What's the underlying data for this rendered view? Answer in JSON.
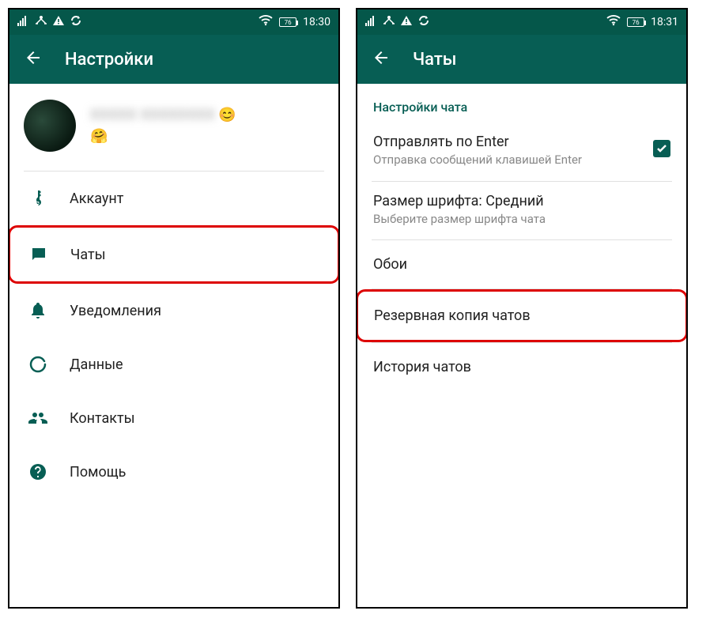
{
  "left": {
    "status": {
      "battery": "76",
      "time": "18:30"
    },
    "title": "Настройки",
    "profile": {
      "name": "XXXXX XXXXXXXX",
      "emoji1": "😊",
      "emoji2": "🤗"
    },
    "menu": {
      "account": "Аккаунт",
      "chats": "Чаты",
      "notifications": "Уведомления",
      "data": "Данные",
      "contacts": "Контакты",
      "help": "Помощь"
    }
  },
  "right": {
    "status": {
      "battery": "76",
      "time": "18:31"
    },
    "title": "Чаты",
    "section": "Настройки чата",
    "enter": {
      "title": "Отправлять по Enter",
      "sub": "Отправка сообщений клавишей Enter"
    },
    "font": {
      "title": "Размер шрифта: Средний",
      "sub": "Выберите размер шрифта чата"
    },
    "wallpaper": "Обои",
    "backup": "Резервная копия чатов",
    "history": "История чатов"
  }
}
